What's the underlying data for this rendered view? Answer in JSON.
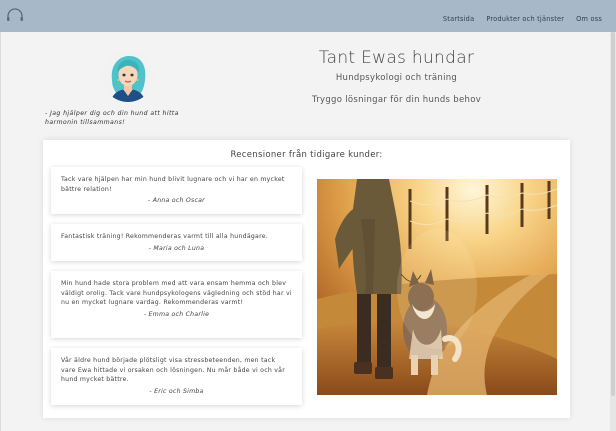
{
  "nav": {
    "items": [
      "Startsida",
      "Produkter och tjänster",
      "Om oss"
    ]
  },
  "hero": {
    "title": "Tant Ewas hundar",
    "subtitle": "Hundpsykologi och träning",
    "motto": "Tryggo lösningar för din hunds behov",
    "tagline": "- Jag hjälper dig och din hund att hitta harmonin tillsammans!"
  },
  "reviews": {
    "heading": "Recensioner från tidigare kunder:",
    "items": [
      {
        "text": "Tack vare hjälpen har min hund blivit lugnare och vi har en mycket bättre relation!",
        "author": "- Anna och Oscar"
      },
      {
        "text": "Fantastisk träning! Rekommenderas varmt till alla hundägare.",
        "author": "- Maria och Luna"
      },
      {
        "text": "Min hund hade stora problem med att vara ensam hemma och blev väldigt orolig. Tack vare hundpsykologens vägledning och stöd har vi nu en mycket lugnare vardag. Rekommenderas varmt!",
        "author": "- Emma och Charlie"
      },
      {
        "text": "Vår äldre hund började plötsligt visa stressbeteenden, men tack vare Ewa hittade vi orsaken och lösningen. Nu mår både vi och vår hund mycket bättre.",
        "author": "- Eric och Simba"
      }
    ]
  },
  "colors": {
    "topbar": "#a7b9c8",
    "background": "#f3f3f3",
    "card": "#ffffff"
  },
  "icons": {
    "logo": "headphones-logo-icon",
    "avatar": "avatar-illustration",
    "photo": "woman-walking-dog-photo"
  }
}
